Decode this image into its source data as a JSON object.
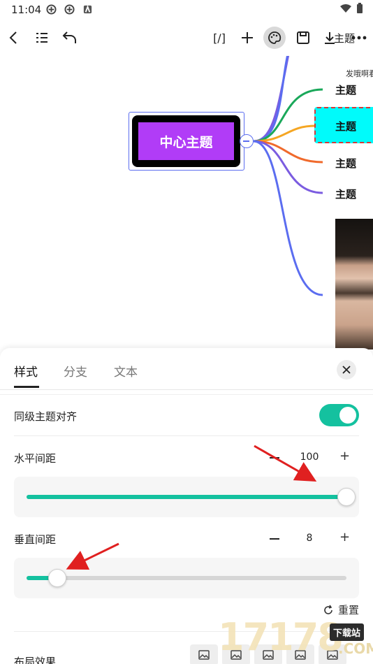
{
  "status_bar": {
    "time": "11:04"
  },
  "toolbar": {
    "back_icon": "arrow-left-icon",
    "outline_icon": "list-icon",
    "undo_icon": "undo-icon",
    "bracket_label": "[/]",
    "add_icon": "plus-icon",
    "style_icon": "palette-icon",
    "save_icon": "save-icon",
    "export_icon": "download-icon",
    "more_icon": "more-icon"
  },
  "canvas": {
    "central_topic": "中心主题",
    "topics": [
      "主题",
      "主题",
      "主题",
      "主题"
    ],
    "note_text": "发哦啊看",
    "top_right_text": "主题",
    "branch_colors": [
      "#7b5ce0",
      "#1aa85a",
      "#f5a623",
      "#f06a2c",
      "#7b5ce0",
      "#5b6df0"
    ]
  },
  "panel": {
    "tabs": [
      "样式",
      "分支",
      "文本"
    ],
    "active_tab": "样式",
    "align_label": "同级主题对齐",
    "align_enabled": true,
    "horizontal_label": "水平间距",
    "horizontal_value": "100",
    "horizontal_fill": 1.0,
    "vertical_label": "垂直间距",
    "vertical_value": "8",
    "vertical_fill": 0.095,
    "reset_label": "重置",
    "bottom_label": "布局效果",
    "minus_label": "−",
    "plus_label": "+"
  },
  "colors": {
    "accent": "#14c19f",
    "central_fill": "#b13cf7",
    "selected_topic": "#00fbfb",
    "annotation_arrow": "#e02020"
  },
  "watermark": {
    "number": "17178",
    "badge": "下载站",
    "suffix": ".COM"
  }
}
